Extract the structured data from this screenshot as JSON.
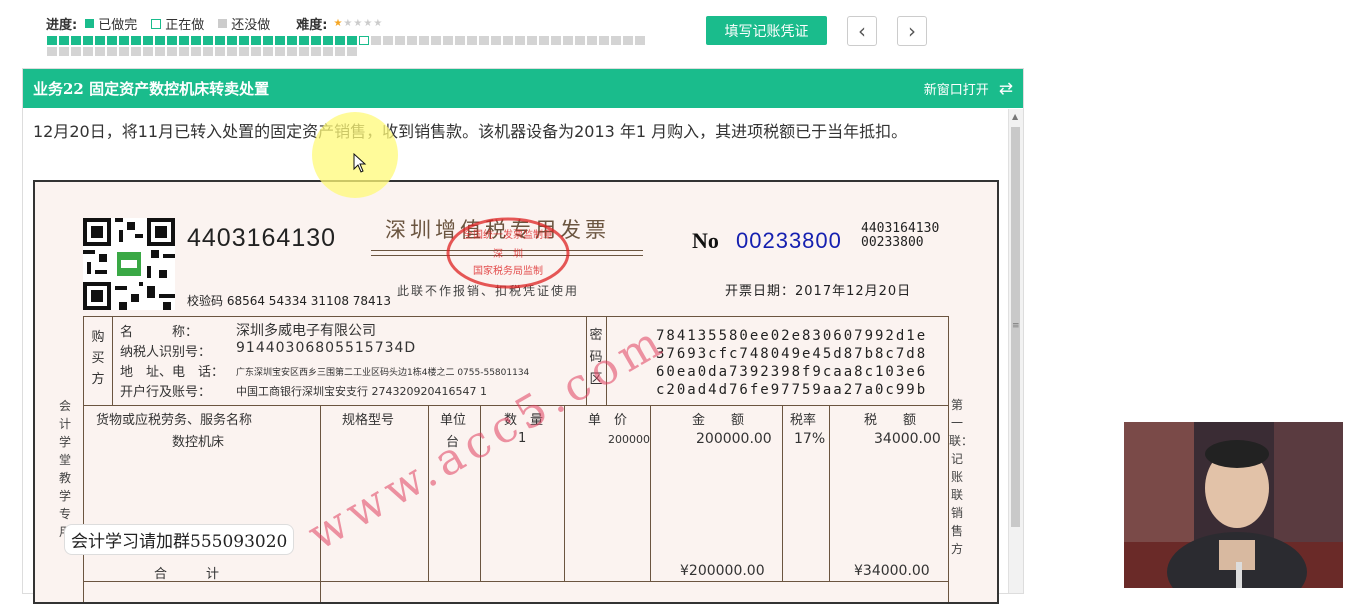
{
  "progress": {
    "label": "进度:",
    "done_label": "已做完",
    "doing_label": "正在做",
    "todo_label": "还没做",
    "difficulty_label": "难度:",
    "difficulty_stars": 1,
    "difficulty_max": 5,
    "done_count": 26,
    "current_index": 26,
    "total": 76,
    "colors": {
      "done": "#1abc8c",
      "todo": "#d4d4d4"
    }
  },
  "toolbar": {
    "voucher_button": "填写记账凭证",
    "prev_icon": "chevron-left-icon",
    "next_icon": "chevron-right-icon",
    "prev_glyph": "‹",
    "next_glyph": "›"
  },
  "panel": {
    "title": "业务22 固定资产数控机床转卖处置",
    "open_new_window": "新窗口打开",
    "swap_icon": "swap-icon",
    "swap_glyph": "⇄",
    "description": "12月20日，将11月已转入处置的固定资产销售，收到销售款。该机器设备为2013 年1 月购入，其进项税额已于当年抵扣。",
    "accent": "#1abc8c"
  },
  "invoice": {
    "code": "4403164130",
    "verify_code": "校验码 68564 54334 31108 78413",
    "title": "深圳增值税专用发票",
    "subtitle": "此联不作报销、扣税凭证使用",
    "seal_top": "全国统一发票监制章",
    "seal_mid": "深 圳",
    "seal_bottom": "国家税务局监制",
    "no_label": "No",
    "no_value": "00233800",
    "code_right_1": "4403164130",
    "code_right_2": "00233800",
    "date": "开票日期：2017年12月20日",
    "side_left": "会计学堂教学专用",
    "side_right": "第一联：记账联 销售方",
    "buyer_section": "购买方",
    "buyer_name_label": "名　　　称：",
    "buyer_name": "深圳多威电子有限公司",
    "buyer_tax_label": "纳税人识别号：",
    "buyer_tax": "91440306805515734D",
    "buyer_addr_label": "地　址、电　话：",
    "buyer_addr": "广东深圳宝安区西乡三围第二工业区码头边1栋4楼之二 0755-55801134",
    "buyer_bank_label": "开户行及账号：",
    "buyer_bank": "中国工商银行深圳宝安支行 274320920416547 1",
    "cipher_section": "密码区",
    "cipher_lines": [
      "784135580ee02e830607992d1e",
      "37693cfc748049e45d87b8c7d8",
      "60ea0da7392398f9caa8c103e6",
      "c20ad4d76fe97759aa27a0c99b"
    ],
    "col_goods": "货物或应税劳务、服务名称",
    "col_spec": "规格型号",
    "col_unit": "单位",
    "col_qty": "数　量",
    "col_price": "单　价",
    "col_amount": "金　　额",
    "col_rate": "税率",
    "col_tax": "税　　额",
    "item_name": "数控机床",
    "item_unit": "台",
    "item_qty": "1",
    "item_price": "200000",
    "item_amount": "200000.00",
    "item_rate": "17%",
    "item_tax": "34000.00",
    "total_label": "合　　　计",
    "total_amount": "¥200000.00",
    "total_tax": "¥34000.00"
  },
  "overlay": {
    "watermark": "www.acc5.com",
    "caption": "会计学习请加群555093020"
  }
}
